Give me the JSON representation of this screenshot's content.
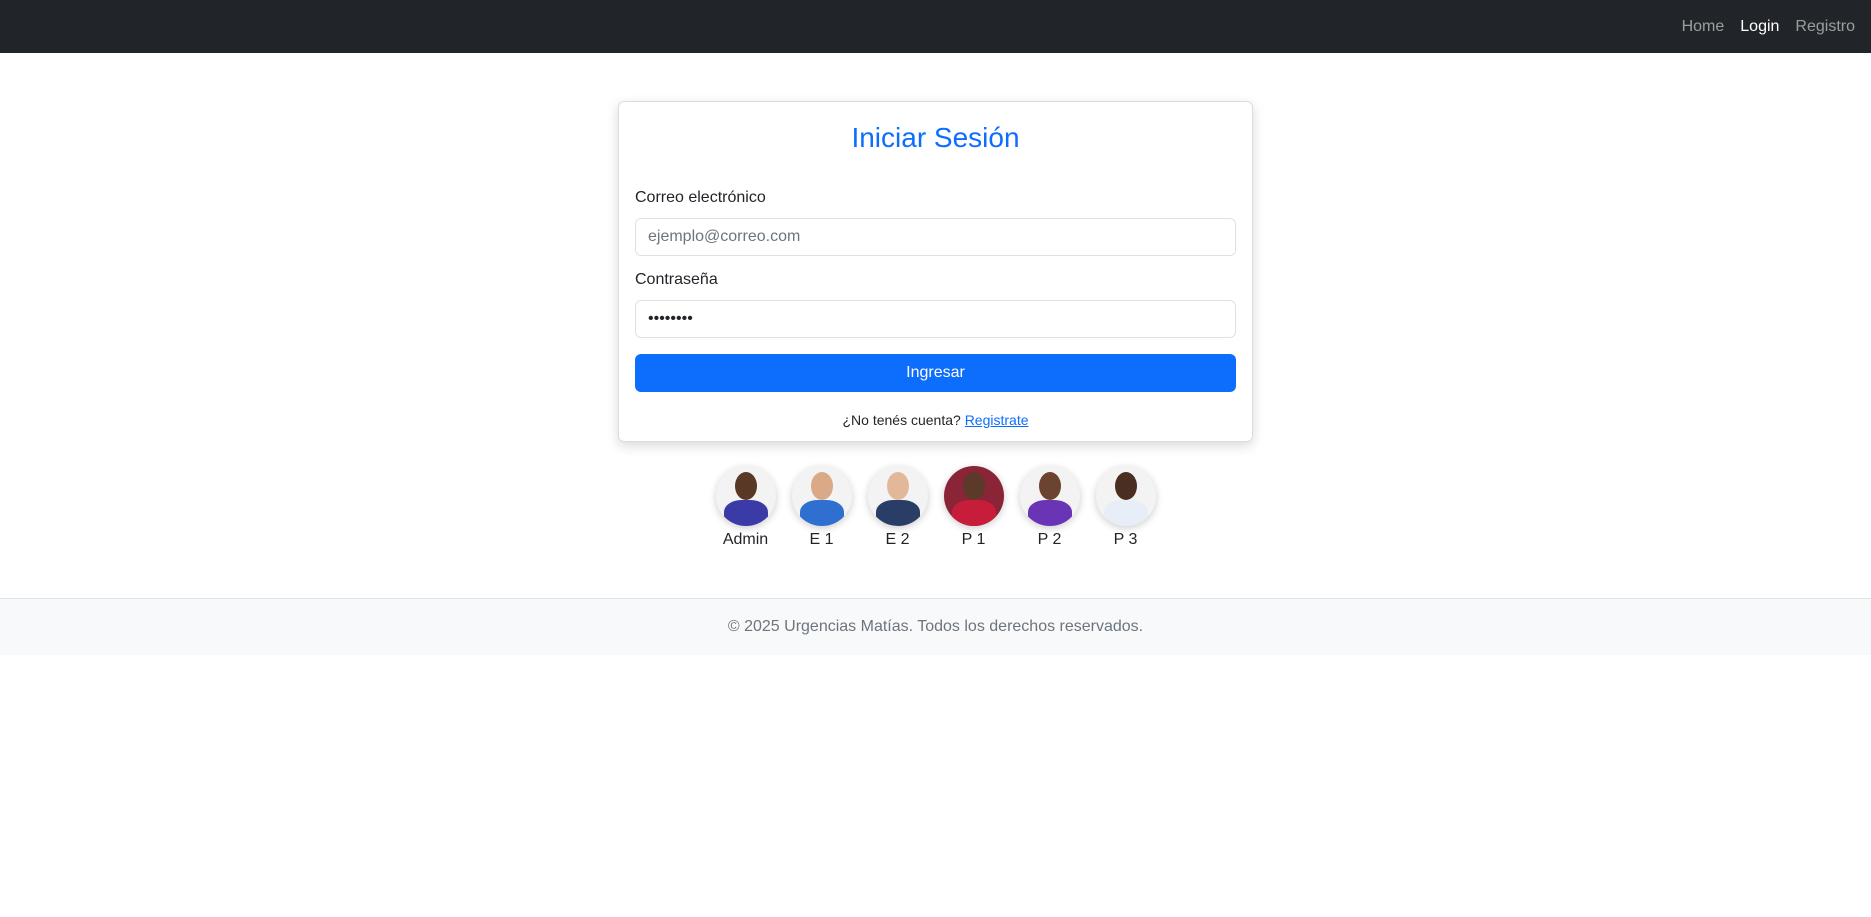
{
  "nav": {
    "items": [
      {
        "label": "Home",
        "active": false
      },
      {
        "label": "Login",
        "active": true
      },
      {
        "label": "Registro",
        "active": false
      }
    ]
  },
  "login": {
    "title": "Iniciar Sesión",
    "email_label": "Correo electrónico",
    "email_placeholder": "ejemplo@correo.com",
    "email_value": "",
    "password_label": "Contraseña",
    "password_value": "password",
    "submit_label": "Ingresar",
    "no_account_text": "¿No tenés cuenta?",
    "register_link": "Registrate"
  },
  "avatars": [
    {
      "label": "Admin",
      "skin": "#5a3826",
      "jersey": "#3b3ba8",
      "bg": "#f3f3f3"
    },
    {
      "label": "E 1",
      "skin": "#d9a988",
      "jersey": "#2f6fd0",
      "bg": "#f3f3f3"
    },
    {
      "label": "E 2",
      "skin": "#e2b89a",
      "jersey": "#2a3d66",
      "bg": "#f3f3f3"
    },
    {
      "label": "P 1",
      "skin": "#5b3a2a",
      "jersey": "#c81d3a",
      "bg": "#8a2437"
    },
    {
      "label": "P 2",
      "skin": "#6b4330",
      "jersey": "#6a35b5",
      "bg": "#f3f3f3"
    },
    {
      "label": "P 3",
      "skin": "#4a2e22",
      "jersey": "#e8eef8",
      "bg": "#f3f3f3"
    }
  ],
  "footer": {
    "text": "© 2025 Urgencias Matías. Todos los derechos reservados."
  },
  "colors": {
    "navbar_bg": "#212529",
    "primary": "#0d6efd",
    "footer_bg": "#f8f9fa"
  }
}
